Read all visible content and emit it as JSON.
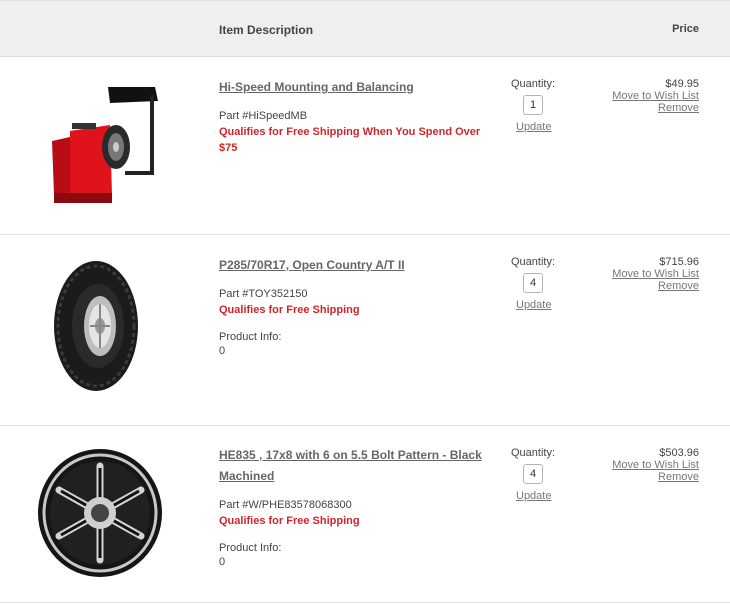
{
  "header": {
    "description_label": "Item Description",
    "price_label": "Price"
  },
  "labels": {
    "quantity": "Quantity:",
    "update": "Update",
    "move_to_wish_list": "Move to Wish List",
    "remove": "Remove",
    "product_info": "Product Info:"
  },
  "items": [
    {
      "title": "Hi-Speed Mounting and Balancing",
      "part": "Part #HiSpeedMB",
      "shipping": "Qualifies for Free Shipping When You Spend Over $75",
      "quantity": "1",
      "price": "$49.95",
      "image": "tire-balancer-machine"
    },
    {
      "title": "P285/70R17, Open Country A/T II",
      "part": "Part #TOY352150",
      "shipping": "Qualifies for Free Shipping",
      "product_info": "0",
      "quantity": "4",
      "price": "$715.96",
      "image": "all-terrain-tire"
    },
    {
      "title": "HE835 , 17x8 with 6 on 5.5 Bolt Pattern - Black Machined",
      "part": "Part #W/PHE83578068300",
      "shipping": "Qualifies for Free Shipping",
      "product_info": "0",
      "quantity": "4",
      "price": "$503.96",
      "image": "black-machined-wheel"
    }
  ],
  "colors": {
    "header_bg": "#efefef",
    "shipping_red": "#d0262b",
    "link_gray": "#777777"
  }
}
